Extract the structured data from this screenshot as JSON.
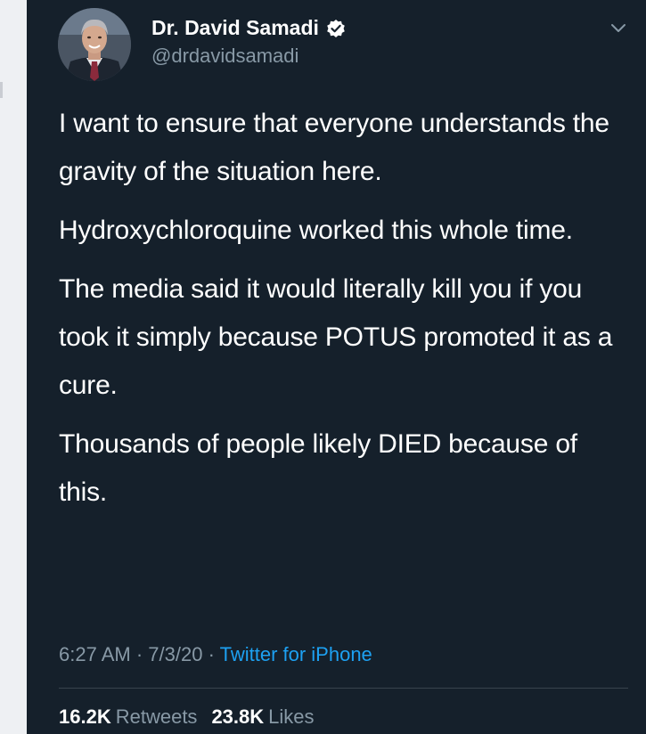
{
  "author": {
    "display_name": "Dr. David Samadi",
    "handle": "@drdavidsamadi",
    "verified": true
  },
  "tweet": {
    "paragraphs": [
      "I want to ensure that everyone understands the gravity of the situation here.",
      "Hydroxychloroquine worked this whole time.",
      "The media said it would literally kill you if you took it simply because POTUS promoted it as a cure.",
      "Thousands of people likely DIED because of this."
    ]
  },
  "meta": {
    "time": "6:27 AM",
    "date": "7/3/20",
    "separator": " · ",
    "source": "Twitter for iPhone"
  },
  "stats": {
    "retweets_count": "16.2K",
    "retweets_label": "Retweets",
    "likes_count": "23.8K",
    "likes_label": "Likes"
  },
  "icons": {
    "verified": "verified-badge-icon",
    "menu": "chevron-down-icon"
  },
  "colors": {
    "background": "#15202b",
    "text": "#ffffff",
    "secondary_text": "#8899a6",
    "link": "#1da1f2",
    "divider": "#38444d"
  }
}
